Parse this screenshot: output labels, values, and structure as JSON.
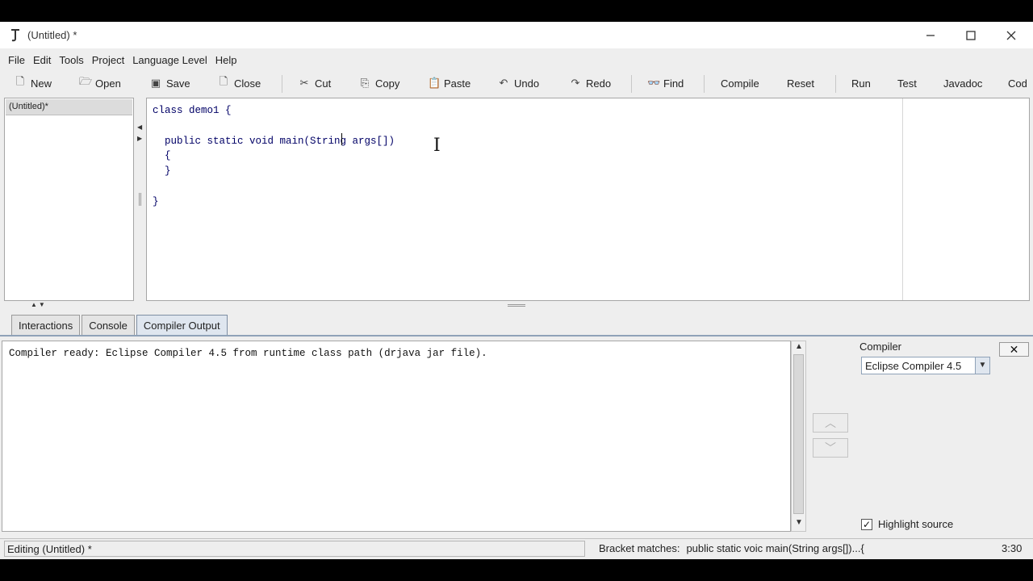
{
  "window": {
    "title": "(Untitled) *"
  },
  "menu": [
    "File",
    "Edit",
    "Tools",
    "Project",
    "Language Level",
    "Help"
  ],
  "toolbar": {
    "new": "New",
    "open": "Open",
    "save": "Save",
    "close": "Close",
    "cut": "Cut",
    "copy": "Copy",
    "paste": "Paste",
    "undo": "Undo",
    "redo": "Redo",
    "find": "Find",
    "compile": "Compile",
    "reset": "Reset",
    "run": "Run",
    "test": "Test",
    "javadoc": "Javadoc",
    "code": "Cod"
  },
  "files": [
    "(Untitled)*"
  ],
  "editor": {
    "code": "class demo1 {\n\n  public static void main(String args[])\n  {\n  }\n\n}"
  },
  "tabs": [
    "Interactions",
    "Console",
    "Compiler Output"
  ],
  "output": {
    "text": "Compiler ready: Eclipse Compiler 4.5 from runtime class path (drjava jar file)."
  },
  "compiler": {
    "label": "Compiler",
    "selected": "Eclipse Compiler 4.5",
    "highlight_label": "Highlight source",
    "highlight_checked": true
  },
  "status": {
    "editing": "Editing (Untitled) *",
    "bracket_label": "Bracket matches:",
    "bracket_value": "public static voic main(String args[])...{",
    "position": "3:30"
  },
  "icons": {
    "app": "drjava-icon",
    "minimize": "minimize-icon",
    "maximize": "maximize-icon",
    "close": "close-icon"
  }
}
